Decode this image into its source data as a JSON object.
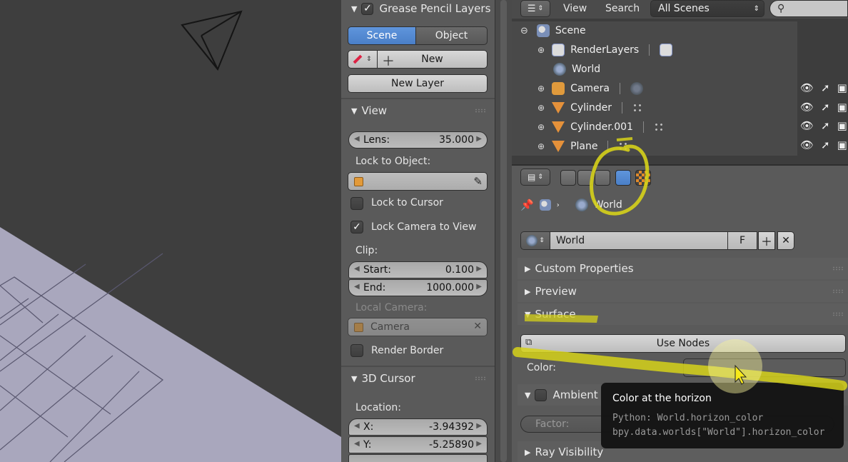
{
  "viewport": {},
  "npanel": {
    "grease_pencil": {
      "header": "Grease Pencil Layers",
      "enabled": true
    },
    "scene_tab": "Scene",
    "object_tab": "Object",
    "new_label": "New",
    "new_layer_label": "New Layer",
    "view_header": "View",
    "lens": {
      "label": "Lens:",
      "value": "35.000"
    },
    "lock_to_object_label": "Lock to Object:",
    "lock_to_cursor": {
      "label": "Lock to Cursor",
      "checked": false
    },
    "lock_camera_to_view": {
      "label": "Lock Camera to View",
      "checked": true
    },
    "clip_label": "Clip:",
    "clip_start": {
      "label": "Start:",
      "value": "0.100"
    },
    "clip_end": {
      "label": "End:",
      "value": "1000.000"
    },
    "local_camera_label": "Local Camera:",
    "local_camera_value": "Camera",
    "render_border": {
      "label": "Render Border",
      "checked": false
    },
    "cursor_header": "3D Cursor",
    "location_label": "Location:",
    "cursor_x": {
      "label": "X:",
      "value": "-3.94392"
    },
    "cursor_y": {
      "label": "Y:",
      "value": "-5.25890"
    }
  },
  "outliner": {
    "menu_view": "View",
    "menu_search": "Search",
    "scenes_dropdown": "All Scenes",
    "items": [
      {
        "label": "Scene"
      },
      {
        "label": "RenderLayers"
      },
      {
        "label": "World"
      },
      {
        "label": "Camera"
      },
      {
        "label": "Cylinder"
      },
      {
        "label": "Cylinder.001"
      },
      {
        "label": "Plane"
      }
    ]
  },
  "properties": {
    "breadcrumb_world": "World",
    "world_datablock": "World",
    "fake_user": "F",
    "panels": {
      "custom_properties": "Custom Properties",
      "preview": "Preview",
      "surface": "Surface",
      "ambient_occlusion": "Ambient",
      "ray_visibility": "Ray Visibility"
    },
    "use_nodes_label": "Use Nodes",
    "color_label": "Color:",
    "factor_label": "Factor:"
  },
  "tooltip": {
    "title": "Color at the horizon",
    "python": "Python: World.horizon_color",
    "path": "bpy.data.worlds[\"World\"].horizon_color"
  },
  "colors": {
    "accent_blue": "#5388d1",
    "highlighter": "#d6d21a",
    "mesh_orange": "#e5913a"
  }
}
